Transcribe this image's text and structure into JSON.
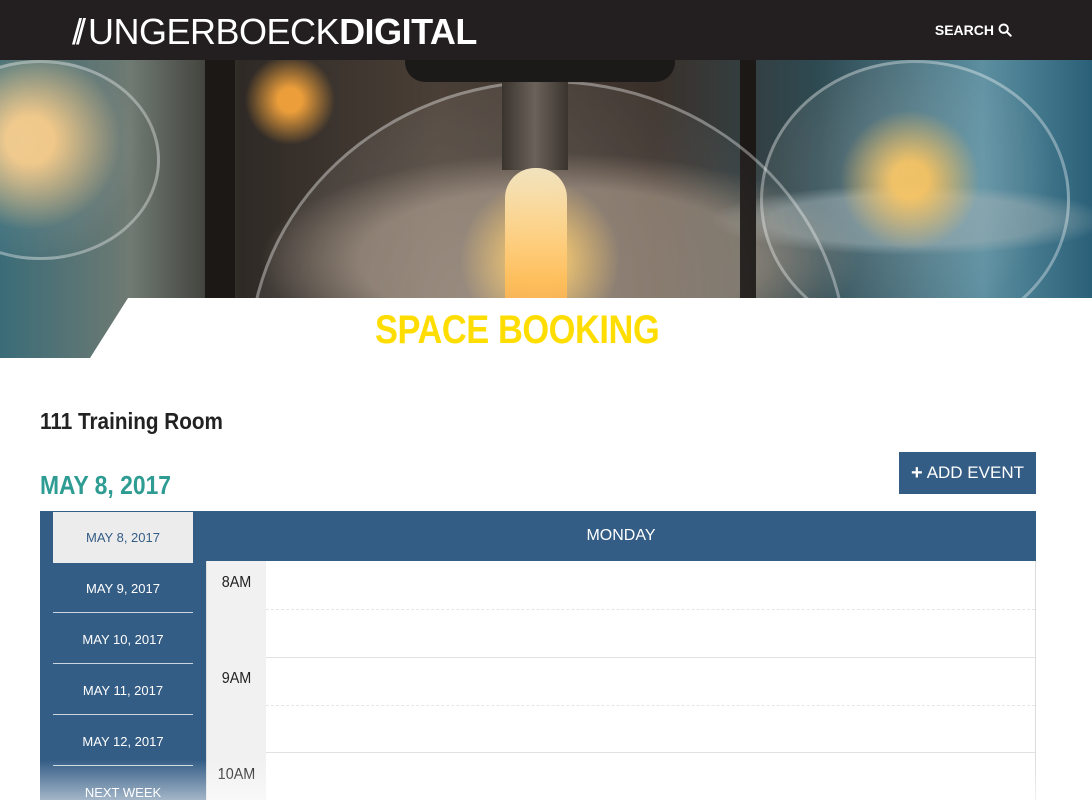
{
  "header": {
    "logo_prefix": "//",
    "logo_light": "UNGERBOECK",
    "logo_bold": "DIGITAL",
    "search_label": "SEARCH",
    "search_icon": "search-icon"
  },
  "page": {
    "title": "SPACE BOOKING",
    "room_name": "111 Training Room",
    "current_date": "MAY 8, 2017",
    "add_event_label": "ADD EVENT",
    "add_event_icon": "plus-icon"
  },
  "calendar": {
    "dates": [
      {
        "label": "MAY 8, 2017",
        "active": true
      },
      {
        "label": "MAY 9, 2017",
        "active": false
      },
      {
        "label": "MAY 10, 2017",
        "active": false
      },
      {
        "label": "MAY 11, 2017",
        "active": false
      },
      {
        "label": "MAY 12, 2017",
        "active": false
      },
      {
        "label": "NEXT WEEK",
        "active": false
      }
    ],
    "day_header": "MONDAY",
    "times": [
      "8AM",
      "9AM",
      "10AM"
    ]
  },
  "colors": {
    "topbar": "#231f20",
    "accent_blue": "#345d86",
    "title_yellow": "#ffdd00",
    "date_teal": "#2e9c92"
  }
}
